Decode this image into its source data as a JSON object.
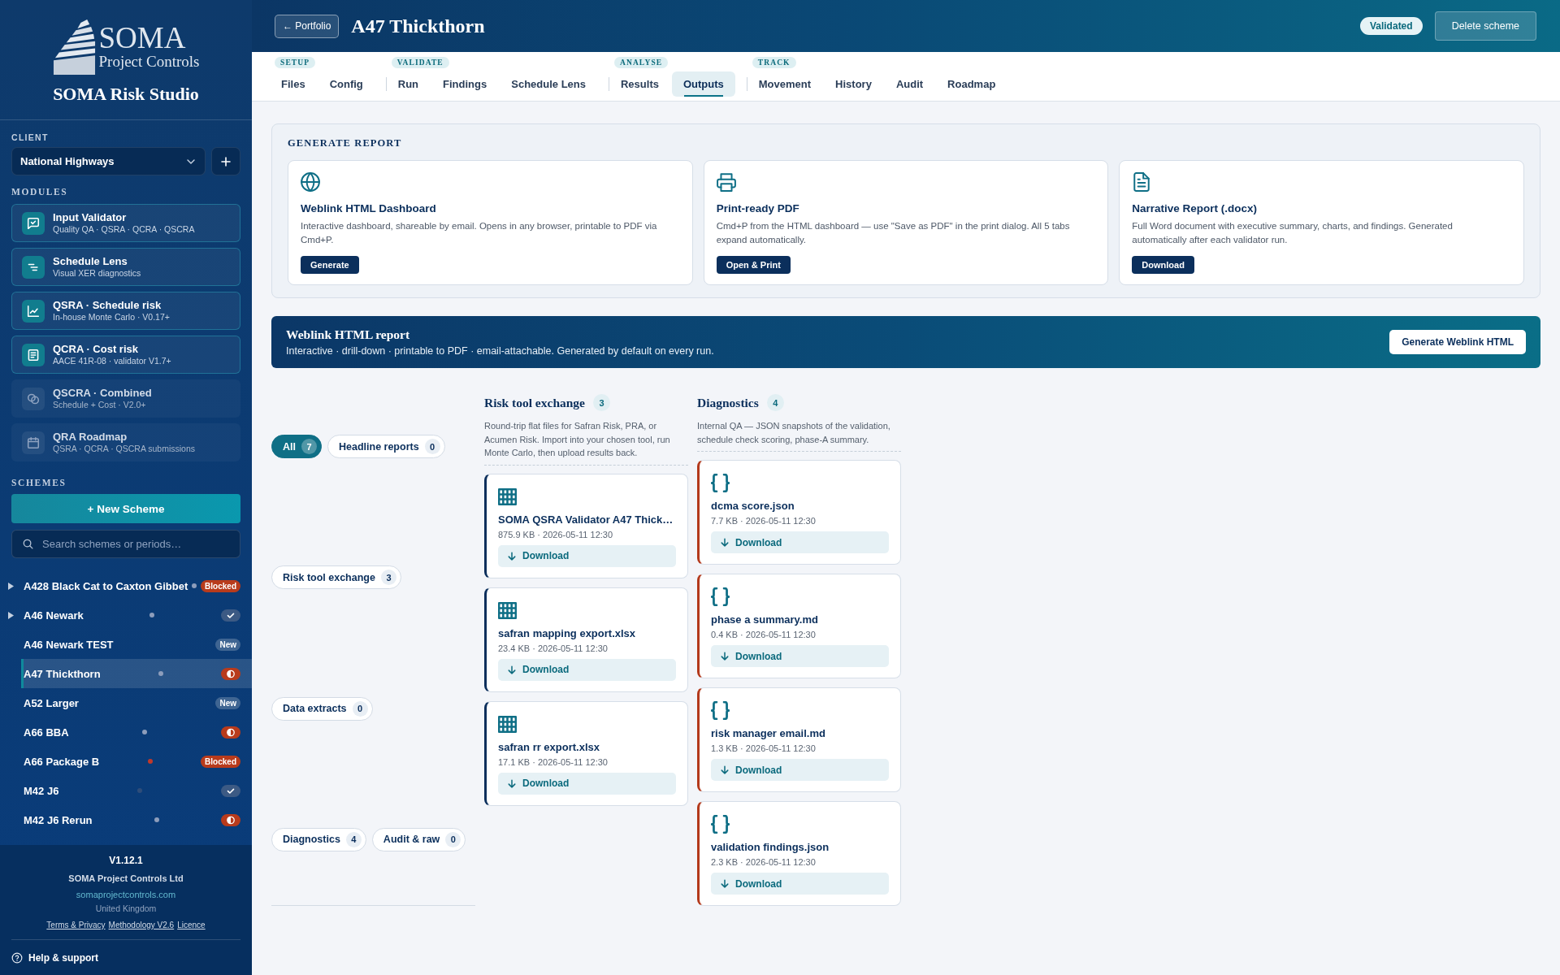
{
  "sidebar": {
    "logo": {
      "wordmark": "SOMA",
      "tagline": "Project Controls"
    },
    "app_name": "SOMA Risk Studio",
    "client": {
      "label": "CLIENT",
      "value": "National Highways"
    },
    "modules_label": "MODULES",
    "modules": [
      {
        "title": "Input Validator",
        "subtitle": "Quality QA · QSRA · QCRA · QSCRA",
        "disabled": false
      },
      {
        "title": "Schedule Lens",
        "subtitle": "Visual XER diagnostics",
        "disabled": false
      },
      {
        "title": "QSRA · Schedule risk",
        "subtitle": "In-house Monte Carlo · V0.17+",
        "disabled": false
      },
      {
        "title": "QCRA · Cost risk",
        "subtitle": "AACE 41R-08 · validator V1.7+",
        "disabled": false
      },
      {
        "title": "QSCRA · Combined",
        "subtitle": "Schedule + Cost · V2.0+",
        "disabled": true
      },
      {
        "title": "QRA Roadmap",
        "subtitle": "QSRA · QCRA · QSCRA submissions",
        "disabled": true
      }
    ],
    "schemes_label": "SCHEMES",
    "new_scheme_button": "+ New Scheme",
    "search": {
      "placeholder": "Search schemes or periods…"
    },
    "schemes": [
      {
        "name": "A428 Black Cat to Caxton Gibbet",
        "collapsible": true,
        "selected": false,
        "color": "#8d9dbb",
        "badge": {
          "kind": "blocked",
          "label": "Blocked"
        }
      },
      {
        "name": "A46 Newark",
        "collapsible": true,
        "selected": false,
        "color": "#8d9dbb",
        "badge": {
          "kind": "done"
        }
      },
      {
        "name": "A46 Newark TEST",
        "collapsible": false,
        "selected": false,
        "badge": {
          "kind": "new",
          "label": "New"
        }
      },
      {
        "name": "A47 Thickthorn",
        "collapsible": false,
        "selected": true,
        "color": "#8d9dbb",
        "badge": {
          "kind": "partial"
        }
      },
      {
        "name": "A52 Larger",
        "collapsible": false,
        "selected": false,
        "badge": {
          "kind": "new",
          "label": "New"
        }
      },
      {
        "name": "A66 BBA",
        "collapsible": false,
        "selected": false,
        "color": "#8d9dbb",
        "badge": {
          "kind": "partial"
        }
      },
      {
        "name": "A66 Package B",
        "collapsible": false,
        "selected": false,
        "color": "#c0392b",
        "badge": {
          "kind": "blocked",
          "label": "Blocked"
        }
      },
      {
        "name": "M42 J6",
        "collapsible": false,
        "selected": false,
        "color": "#2e4d7a",
        "badge": {
          "kind": "done"
        }
      },
      {
        "name": "M42 J6 Rerun",
        "collapsible": false,
        "selected": false,
        "color": "#8d9dbb",
        "badge": {
          "kind": "partial"
        }
      }
    ],
    "footer": {
      "version": "V1.12.1",
      "company": "SOMA Project Controls Ltd",
      "website": "somaprojectcontrols.com",
      "country": "United Kingdom",
      "links": [
        "Terms & Privacy",
        "Methodology V2.6",
        "Licence"
      ],
      "help": "Help & support"
    }
  },
  "header": {
    "back_button": "← Portfolio",
    "title": "A47 Thickthorn",
    "status_badge": "Validated",
    "delete_button": "Delete scheme"
  },
  "tab_groups": [
    {
      "label": "SETUP",
      "tabs": [
        {
          "label": "Files",
          "selected": false
        },
        {
          "label": "Config",
          "selected": false
        }
      ]
    },
    {
      "label": "VALIDATE",
      "tabs": [
        {
          "label": "Run",
          "selected": false
        },
        {
          "label": "Findings",
          "selected": false
        },
        {
          "label": "Schedule Lens",
          "selected": false
        }
      ]
    },
    {
      "label": "ANALYSE",
      "tabs": [
        {
          "label": "Results",
          "selected": false
        },
        {
          "label": "Outputs",
          "selected": true
        }
      ]
    },
    {
      "label": "TRACK",
      "tabs": [
        {
          "label": "Movement",
          "selected": false
        },
        {
          "label": "History",
          "selected": false
        },
        {
          "label": "Audit",
          "selected": false
        },
        {
          "label": "Roadmap",
          "selected": false
        }
      ]
    }
  ],
  "generate_report": {
    "title": "GENERATE REPORT",
    "cards": [
      {
        "title": "Weblink HTML Dashboard",
        "description": "Interactive dashboard, shareable by email. Opens in any browser, printable to PDF via Cmd+P.",
        "button": "Generate"
      },
      {
        "title": "Print-ready PDF",
        "description": "Cmd+P from the HTML dashboard — use \"Save as PDF\" in the print dialog. All 5 tabs expand automatically.",
        "button": "Open & Print"
      },
      {
        "title": "Narrative Report (.docx)",
        "description": "Full Word document with executive summary, charts, and findings. Generated automatically after each validator run.",
        "button": "Download"
      }
    ]
  },
  "weblink_banner": {
    "title": "Weblink HTML report",
    "subtitle": "Interactive · drill-down · printable to PDF · email-attachable. Generated by default on every run.",
    "button": "Generate Weblink HTML"
  },
  "filters": [
    {
      "label": "All",
      "count": "7",
      "selected": true
    },
    {
      "label": "Headline reports",
      "count": "0",
      "selected": false
    },
    {
      "label": "Risk tool exchange",
      "count": "3",
      "selected": false
    },
    {
      "label": "Data extracts",
      "count": "0",
      "selected": false
    },
    {
      "label": "Diagnostics",
      "count": "4",
      "selected": false
    },
    {
      "label": "Audit & raw",
      "count": "0",
      "selected": false
    }
  ],
  "sections": [
    {
      "kind": "spreadsheet",
      "title": "Risk tool exchange",
      "count": "3",
      "description": "Round-trip flat files for Safran Risk, PRA, or Acumen Risk. Import into your chosen tool, run Monte Carlo, then upload results back.",
      "files": [
        {
          "name": "SOMA QSRA Validator A47 Thick…",
          "meta": "875.9 KB · 2026-05-11 12:30",
          "button": "Download"
        },
        {
          "name": "safran mapping export.xlsx",
          "meta": "23.4 KB · 2026-05-11 12:30",
          "button": "Download"
        },
        {
          "name": "safran rr export.xlsx",
          "meta": "17.1 KB · 2026-05-11 12:30",
          "button": "Download"
        }
      ]
    },
    {
      "kind": "json",
      "title": "Diagnostics",
      "count": "4",
      "description": "Internal QA — JSON snapshots of the validation, schedule check scoring, phase-A summary.",
      "files": [
        {
          "name": "dcma score.json",
          "meta": "7.7 KB · 2026-05-11 12:30",
          "button": "Download"
        },
        {
          "name": "phase a summary.md",
          "meta": "0.4 KB · 2026-05-11 12:30",
          "button": "Download"
        },
        {
          "name": "risk manager email.md",
          "meta": "1.3 KB · 2026-05-11 12:30",
          "button": "Download"
        },
        {
          "name": "validation findings.json",
          "meta": "2.3 KB · 2026-05-11 12:30",
          "button": "Download"
        }
      ]
    }
  ]
}
